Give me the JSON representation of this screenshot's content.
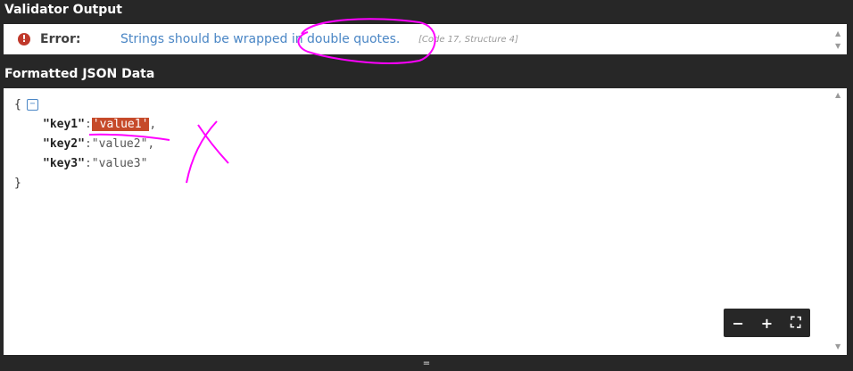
{
  "validator": {
    "title": "Validator Output",
    "error_label": "Error:",
    "message": "Strings should be wrapped in double quotes.",
    "code": "[Code 17, Structure 4]"
  },
  "formatted": {
    "title": "Formatted JSON Data",
    "open_brace": "{",
    "close_brace": "}",
    "collapse_symbol": "−",
    "lines": [
      {
        "key": "\"key1\"",
        "colon": ":",
        "value": "'value1'",
        "comma": ","
      },
      {
        "key": "\"key2\"",
        "colon": ":",
        "value": "\"value2\"",
        "comma": ","
      },
      {
        "key": "\"key3\"",
        "colon": ":",
        "value": "\"value3\"",
        "comma": ""
      }
    ]
  },
  "zoom": {
    "minus": "−",
    "plus": "+",
    "fullscreen": "⛶"
  },
  "resize_handle": "=",
  "colors": {
    "background": "#272727",
    "error_icon": "#c0392b",
    "message": "#4a86c5",
    "error_value_bg": "#c64a2a",
    "annotation": "#ff00ff"
  }
}
